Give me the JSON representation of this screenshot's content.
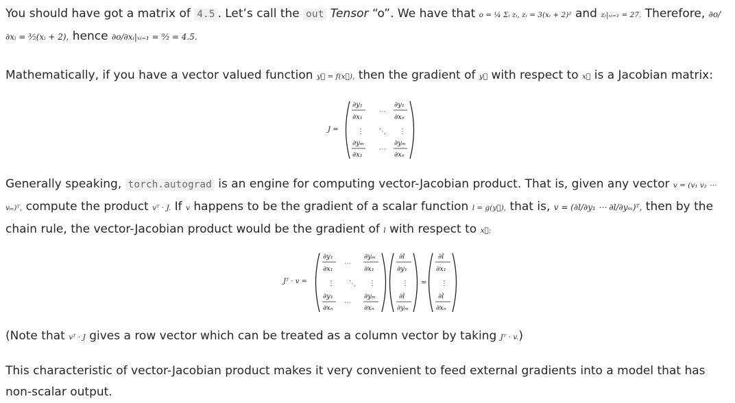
{
  "p1": {
    "pre": "You should have got a matrix of",
    "value": "4.5",
    "mid": ". Let’s call the",
    "out_code": "out",
    "tensor": "Tensor",
    "quote": "“o”. We have that",
    "math1": "o = ¼ Σᵢ zᵢ,  zᵢ = 3(xᵢ + 2)²",
    "and": "and",
    "math2": "zᵢ|ₓᵢ₌₁ = 27.",
    "therefore": "Therefore,",
    "math3": "∂o/∂xᵢ = ³⁄₂(xᵢ + 2),",
    "hence": "hence",
    "math4": "∂o/∂xᵢ|ₓᵢ₌₁ = ⁹⁄₂ = 4.5."
  },
  "p2": {
    "pre": "Mathematically, if you have a vector valued function",
    "m_func": "y⃗ = f(x⃗),",
    "mid": "then the gradient of",
    "m_y": "y⃗",
    "mid2": "with respect to",
    "m_x": "x⃗",
    "post": "is a Jacobian matrix:"
  },
  "eq1": {
    "lhs": "J =",
    "cells": [
      {
        "num": "∂y₁",
        "den": "∂x₁"
      },
      {
        "num": "∂y₁",
        "den": "∂xₙ"
      },
      {
        "num": "∂yₘ",
        "den": "∂x₁"
      },
      {
        "num": "∂yₘ",
        "den": "∂xₙ"
      }
    ],
    "hdots": "⋯",
    "vdots": "⋮",
    "ddots": "⋱"
  },
  "p3": {
    "pre": "Generally speaking,",
    "code": "torch.autograd",
    "mid": "is an engine for computing vector-Jacobian product. That is, given any vector",
    "m_v": "v = (v₁  v₂  ⋯  vₘ)ᵀ,",
    "compute": "compute the product",
    "m_vtj": "vᵀ · J.",
    "if": "If",
    "m_v2": "v",
    "happens": "happens to be the gradient of a scalar function",
    "m_l": "l = g(y⃗),",
    "that_is": "that is,",
    "m_vdef": "v = (∂l/∂y₁  ⋯  ∂l/∂yₘ)ᵀ,",
    "then": "then by the chain rule, the vector-Jacobian product would be the gradient of",
    "m_l2": "l",
    "wrt": "with respect to",
    "m_x": "x⃗:"
  },
  "eq2": {
    "lhs": "Jᵀ · v =",
    "mat": [
      {
        "num": "∂y₁",
        "den": "∂x₁"
      },
      {
        "num": "∂yₘ",
        "den": "∂x₁"
      },
      {
        "num": "∂y₁",
        "den": "∂xₙ"
      },
      {
        "num": "∂yₘ",
        "den": "∂xₙ"
      }
    ],
    "vec": [
      {
        "num": "∂l",
        "den": "∂y₁"
      },
      {
        "num": "∂l",
        "den": "∂yₘ"
      }
    ],
    "eq": "=",
    "res": [
      {
        "num": "∂l",
        "den": "∂x₁"
      },
      {
        "num": "∂l",
        "den": "∂xₙ"
      }
    ],
    "hdots": "⋯",
    "vdots": "⋮",
    "ddots": "⋱"
  },
  "p4": {
    "pre": "(Note that",
    "m1": "vᵀ · J",
    "mid": "gives a row vector which can be treated as a column vector by taking",
    "m2": "Jᵀ · v.",
    "post": ")"
  },
  "p5": {
    "text": "This characteristic of vector-Jacobian product makes it very convenient to feed external gradients into a model that has non-scalar output."
  }
}
